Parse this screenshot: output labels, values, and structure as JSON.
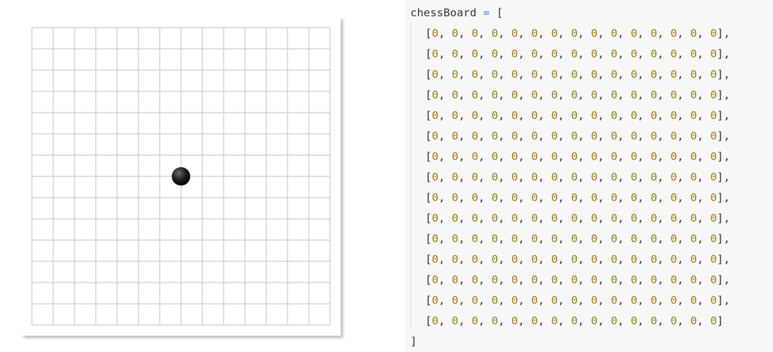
{
  "board": {
    "size": 15,
    "stones": [
      {
        "row": 7,
        "col": 7,
        "color": "black"
      }
    ]
  },
  "code": {
    "variable": "chessBoard",
    "operator": "=",
    "open_bracket": "[",
    "close_bracket": "]",
    "rows": [
      [
        0,
        0,
        0,
        0,
        0,
        0,
        0,
        0,
        0,
        0,
        0,
        0,
        0,
        0,
        0
      ],
      [
        0,
        0,
        0,
        0,
        0,
        0,
        0,
        0,
        0,
        0,
        0,
        0,
        0,
        0,
        0
      ],
      [
        0,
        0,
        0,
        0,
        0,
        0,
        0,
        0,
        0,
        0,
        0,
        0,
        0,
        0,
        0
      ],
      [
        0,
        0,
        0,
        0,
        0,
        0,
        0,
        0,
        0,
        0,
        0,
        0,
        0,
        0,
        0
      ],
      [
        0,
        0,
        0,
        0,
        0,
        0,
        0,
        0,
        0,
        0,
        0,
        0,
        0,
        0,
        0
      ],
      [
        0,
        0,
        0,
        0,
        0,
        0,
        0,
        0,
        0,
        0,
        0,
        0,
        0,
        0,
        0
      ],
      [
        0,
        0,
        0,
        0,
        0,
        0,
        0,
        0,
        0,
        0,
        0,
        0,
        0,
        0,
        0
      ],
      [
        0,
        0,
        0,
        0,
        0,
        0,
        0,
        0,
        0,
        0,
        0,
        0,
        0,
        0,
        0
      ],
      [
        0,
        0,
        0,
        0,
        0,
        0,
        0,
        0,
        0,
        0,
        0,
        0,
        0,
        0,
        0
      ],
      [
        0,
        0,
        0,
        0,
        0,
        0,
        0,
        0,
        0,
        0,
        0,
        0,
        0,
        0,
        0
      ],
      [
        0,
        0,
        0,
        0,
        0,
        0,
        0,
        0,
        0,
        0,
        0,
        0,
        0,
        0,
        0
      ],
      [
        0,
        0,
        0,
        0,
        0,
        0,
        0,
        0,
        0,
        0,
        0,
        0,
        0,
        0,
        0
      ],
      [
        0,
        0,
        0,
        0,
        0,
        0,
        0,
        0,
        0,
        0,
        0,
        0,
        0,
        0,
        0
      ],
      [
        0,
        0,
        0,
        0,
        0,
        0,
        0,
        0,
        0,
        0,
        0,
        0,
        0,
        0,
        0
      ],
      [
        0,
        0,
        0,
        0,
        0,
        0,
        0,
        0,
        0,
        0,
        0,
        0,
        0,
        0,
        0
      ]
    ]
  },
  "colors": {
    "grid_line": "#cccccc",
    "number": "#9b7a1c",
    "operator": "#3a7fc7",
    "text": "#333333",
    "code_background": "#f7f7f7"
  }
}
